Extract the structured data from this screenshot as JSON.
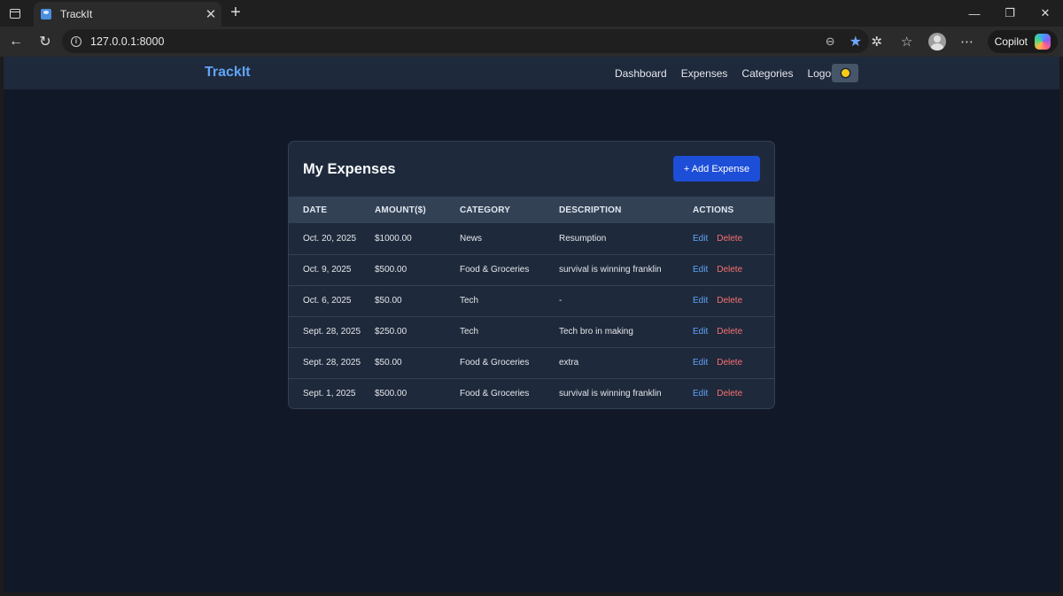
{
  "browser": {
    "tab_title": "TrackIt",
    "url": "127.0.0.1:8000",
    "copilot_label": "Copilot"
  },
  "nav": {
    "brand": "TrackIt",
    "links": [
      "Dashboard",
      "Expenses",
      "Categories",
      "Logout"
    ]
  },
  "card": {
    "title": "My Expenses",
    "add_label": "+ Add Expense",
    "headers": [
      "DATE",
      "AMOUNT($)",
      "CATEGORY",
      "DESCRIPTION",
      "ACTIONS"
    ],
    "rows": [
      {
        "date": "Oct. 20, 2025",
        "amount": "$1000.00",
        "category": "News",
        "description": "Resumption"
      },
      {
        "date": "Oct. 9, 2025",
        "amount": "$500.00",
        "category": "Food & Groceries",
        "description": "survival is winning franklin"
      },
      {
        "date": "Oct. 6, 2025",
        "amount": "$50.00",
        "category": "Tech",
        "description": "-"
      },
      {
        "date": "Sept. 28, 2025",
        "amount": "$250.00",
        "category": "Tech",
        "description": "Tech bro in making"
      },
      {
        "date": "Sept. 28, 2025",
        "amount": "$50.00",
        "category": "Food & Groceries",
        "description": "extra"
      },
      {
        "date": "Sept. 1, 2025",
        "amount": "$500.00",
        "category": "Food & Groceries",
        "description": "survival is winning franklin"
      }
    ],
    "edit_label": "Edit",
    "delete_label": "Delete"
  },
  "colors": {
    "page_bg": "#111827",
    "card_bg": "#1e293b",
    "brand": "#60a5fa",
    "primary": "#1d4ed8",
    "danger": "#f87171"
  }
}
